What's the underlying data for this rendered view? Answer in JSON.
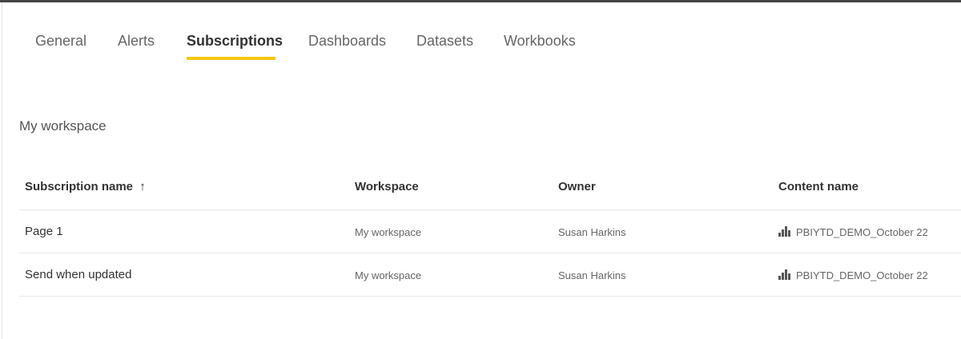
{
  "tabs": [
    "General",
    "Alerts",
    "Subscriptions",
    "Dashboards",
    "Datasets",
    "Workbooks"
  ],
  "active_tab": "Subscriptions",
  "accent": "#F2C811",
  "section_title": "My workspace",
  "table": {
    "headers": [
      "Subscription name",
      "Workspace",
      "Owner",
      "Content name"
    ],
    "sort_icon": "↑",
    "rows": [
      {
        "name": "Page 1",
        "workspace": "My workspace",
        "owner": "Susan Harkins",
        "content": "PBIYTD_DEMO_October 22",
        "content_icon": "report-chart-icon"
      },
      {
        "name": "Send when updated",
        "workspace": "My workspace",
        "owner": "Susan Harkins",
        "content": "PBIYTD_DEMO_October 22",
        "content_icon": "report-chart-icon"
      }
    ]
  }
}
